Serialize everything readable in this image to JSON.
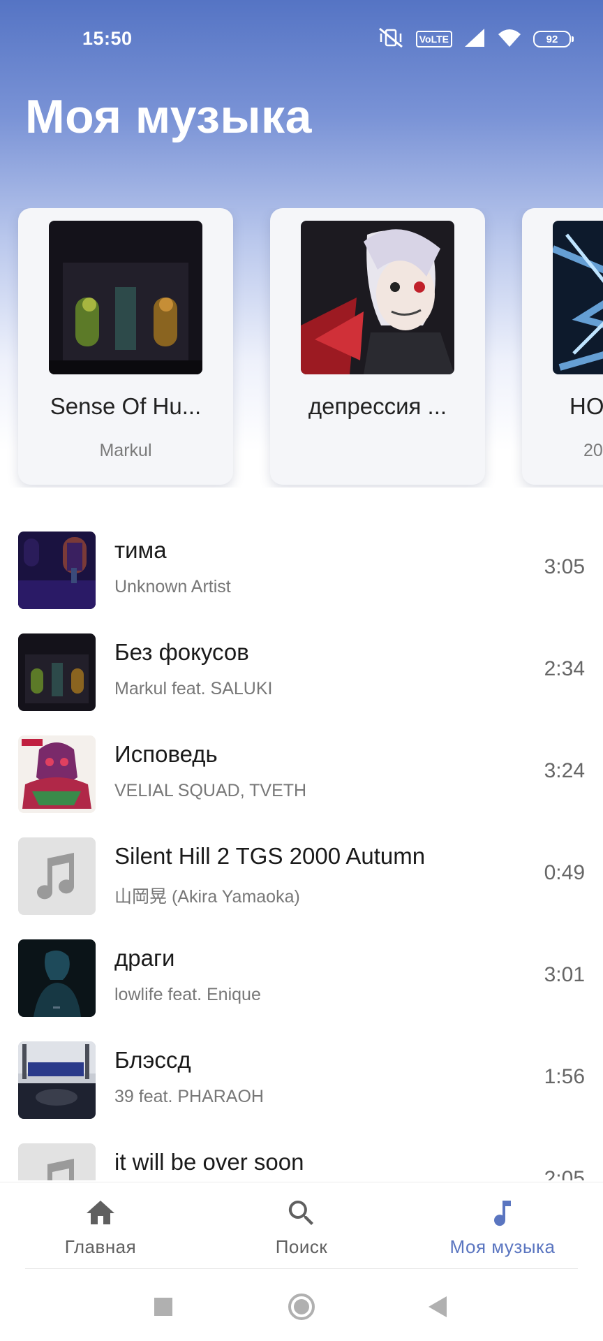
{
  "status_bar": {
    "time": "15:50",
    "network_badge": "VoLTE",
    "battery_level": "92",
    "icons": [
      "vibrate-mute-icon",
      "signal-icon",
      "wifi-icon",
      "battery-icon"
    ]
  },
  "page_title": "Моя музыка",
  "albums": [
    {
      "title": "Sense Of Hu...",
      "artist": "Markul"
    },
    {
      "title": "депрессия ...",
      "artist": ""
    },
    {
      "title": "HO",
      "artist": "20"
    }
  ],
  "tracks": [
    {
      "title": "тима",
      "artist": "Unknown Artist",
      "duration": "3:05"
    },
    {
      "title": "Без фокусов",
      "artist": "Markul feat. SALUKI",
      "duration": "2:34"
    },
    {
      "title": "Исповедь",
      "artist": "VELIAL SQUAD, TVETH",
      "duration": "3:24"
    },
    {
      "title": "Silent Hill 2 TGS 2000 Autumn",
      "artist": "山岡晃 (Akira Yamaoka)",
      "duration": "0:49"
    },
    {
      "title": "драги",
      "artist": "lowlife feat. Enique",
      "duration": "3:01"
    },
    {
      "title": "Блэссд",
      "artist": "39 feat. PHARAOH",
      "duration": "1:56"
    },
    {
      "title": "it will be over soon",
      "artist": "",
      "duration": "2:05"
    }
  ],
  "bottom_nav": [
    {
      "label": "Главная",
      "icon": "home-icon"
    },
    {
      "label": "Поиск",
      "icon": "search-icon"
    },
    {
      "label": "Моя музыка",
      "icon": "music-note-icon",
      "active": true
    }
  ],
  "colors": {
    "header_gradient_top": "#5574c4",
    "accent": "#5a75c0",
    "inactive_nav": "#606060"
  }
}
